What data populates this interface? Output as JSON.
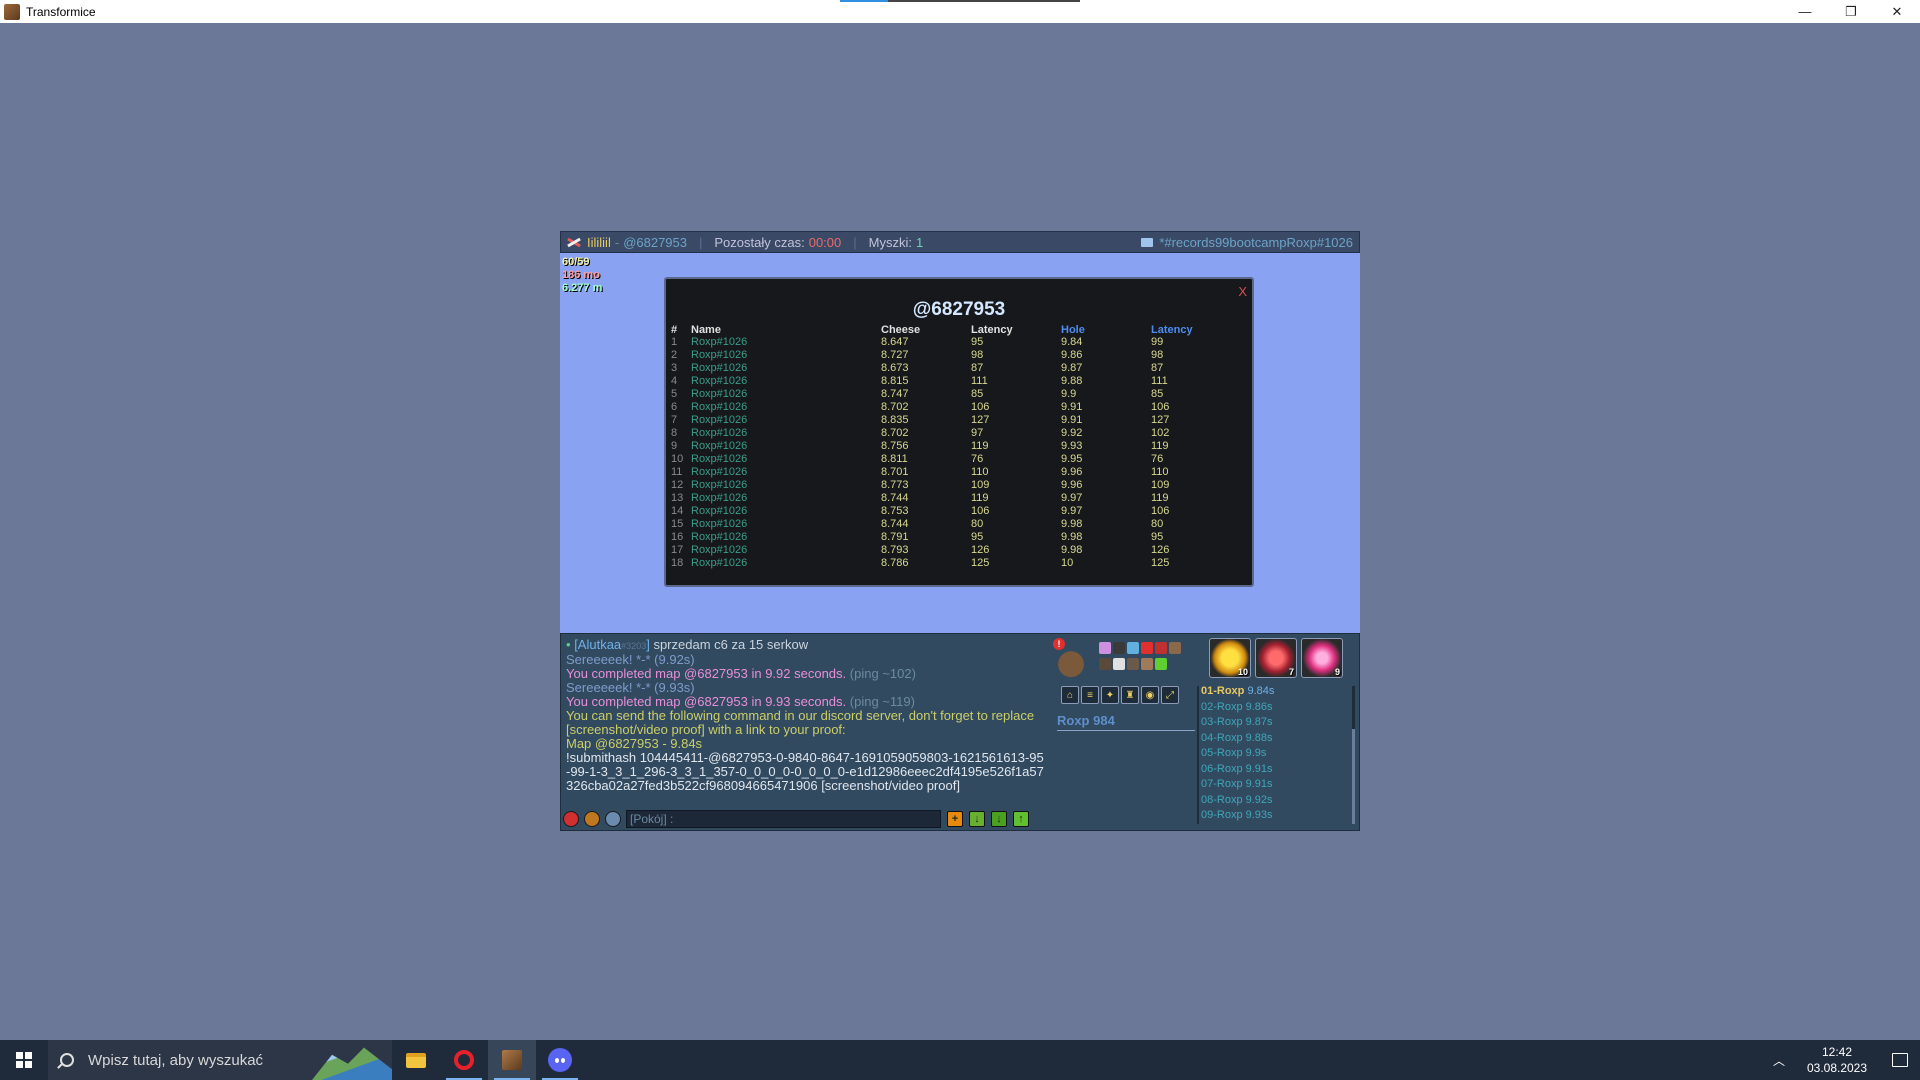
{
  "window": {
    "title": "Transformice",
    "controls": [
      "—",
      "❐",
      "✕"
    ]
  },
  "topbar": {
    "player": "Iililiil",
    "separator_dash": "-",
    "map": "@6827953",
    "time_label": "Pozostały czas:",
    "time_value": "00:00",
    "mice_label": "Myszki:",
    "mice_value": "1",
    "room": "*#records99bootcampRoxp#1026"
  },
  "stats": {
    "line1": "60/59",
    "line2": "186 mo",
    "line3": "6.277 m"
  },
  "leaderboard": {
    "title": "@6827953",
    "close_label": "X",
    "headers": [
      "#",
      "Name",
      "Cheese",
      "Latency",
      "Hole",
      "Latency"
    ],
    "rows": [
      [
        "1",
        "Roxp#1026",
        "8.647",
        "95",
        "9.84",
        "99"
      ],
      [
        "2",
        "Roxp#1026",
        "8.727",
        "98",
        "9.86",
        "98"
      ],
      [
        "3",
        "Roxp#1026",
        "8.673",
        "87",
        "9.87",
        "87"
      ],
      [
        "4",
        "Roxp#1026",
        "8.815",
        "111",
        "9.88",
        "111"
      ],
      [
        "5",
        "Roxp#1026",
        "8.747",
        "85",
        "9.9",
        "85"
      ],
      [
        "6",
        "Roxp#1026",
        "8.702",
        "106",
        "9.91",
        "106"
      ],
      [
        "7",
        "Roxp#1026",
        "8.835",
        "127",
        "9.91",
        "127"
      ],
      [
        "8",
        "Roxp#1026",
        "8.702",
        "97",
        "9.92",
        "102"
      ],
      [
        "9",
        "Roxp#1026",
        "8.756",
        "119",
        "9.93",
        "119"
      ],
      [
        "10",
        "Roxp#1026",
        "8.811",
        "76",
        "9.95",
        "76"
      ],
      [
        "11",
        "Roxp#1026",
        "8.701",
        "110",
        "9.96",
        "110"
      ],
      [
        "12",
        "Roxp#1026",
        "8.773",
        "109",
        "9.96",
        "109"
      ],
      [
        "13",
        "Roxp#1026",
        "8.744",
        "119",
        "9.97",
        "119"
      ],
      [
        "14",
        "Roxp#1026",
        "8.753",
        "106",
        "9.97",
        "106"
      ],
      [
        "15",
        "Roxp#1026",
        "8.744",
        "80",
        "9.98",
        "80"
      ],
      [
        "16",
        "Roxp#1026",
        "8.791",
        "95",
        "9.98",
        "95"
      ],
      [
        "17",
        "Roxp#1026",
        "8.793",
        "126",
        "9.98",
        "126"
      ],
      [
        "18",
        "Roxp#1026",
        "8.786",
        "125",
        "10",
        "125"
      ]
    ]
  },
  "chat": {
    "first_bullet": "•",
    "first_name": "[Alutkaa",
    "first_tag": "#3203",
    "first_name_end": "]",
    "first_text": "sprzedam c6 za 15 serkow",
    "squeak1": "Sereeeeek! *-* (9.92s)",
    "done1": "You completed map @6827953 in 9.92 seconds.",
    "ping1": "(ping ~102)",
    "squeak2": "Sereeeeek! *-* (9.93s)",
    "done2": "You completed map @6827953 in 9.93 seconds.",
    "ping2": "(ping ~119)",
    "info": "You can send the following command in our discord server, don't forget to replace [screenshot/video proof] with a link to your proof:",
    "map_line": "Map @6827953 - 9.84s",
    "command": "!submithash 104445411-@6827953-0-9840-8647-1691059059803-1621561613-95-99-1-3_3_1_296-3_3_1_357-0_0_0_0-0_0_0_0-e1d12986eeec2df4195e526f1a57326cba02a27fed3b522cf968094665471906 [screenshot/video proof]",
    "input_placeholder": "[Pokój] :"
  },
  "player_panel": {
    "alert": "!",
    "name": "Roxp 984"
  },
  "powerups": [
    {
      "name": "sun-powerup-icon",
      "count": "10"
    },
    {
      "name": "hearts-powerup-icon",
      "count": "7"
    },
    {
      "name": "flower-powerup-icon",
      "count": "9"
    }
  ],
  "ranking": {
    "first": {
      "label": "01-Roxp",
      "time": "9.84s"
    },
    "rest": [
      "02-Roxp 9.86s",
      "03-Roxp 9.87s",
      "04-Roxp 9.88s",
      "05-Roxp 9.9s",
      "06-Roxp 9.91s",
      "07-Roxp 9.91s",
      "08-Roxp 9.92s",
      "09-Roxp 9.93s"
    ]
  },
  "taskbar": {
    "search_placeholder": "Wpisz tutaj, aby wyszukać",
    "chevron": "︿",
    "time": "12:42",
    "date": "03.08.2023"
  }
}
